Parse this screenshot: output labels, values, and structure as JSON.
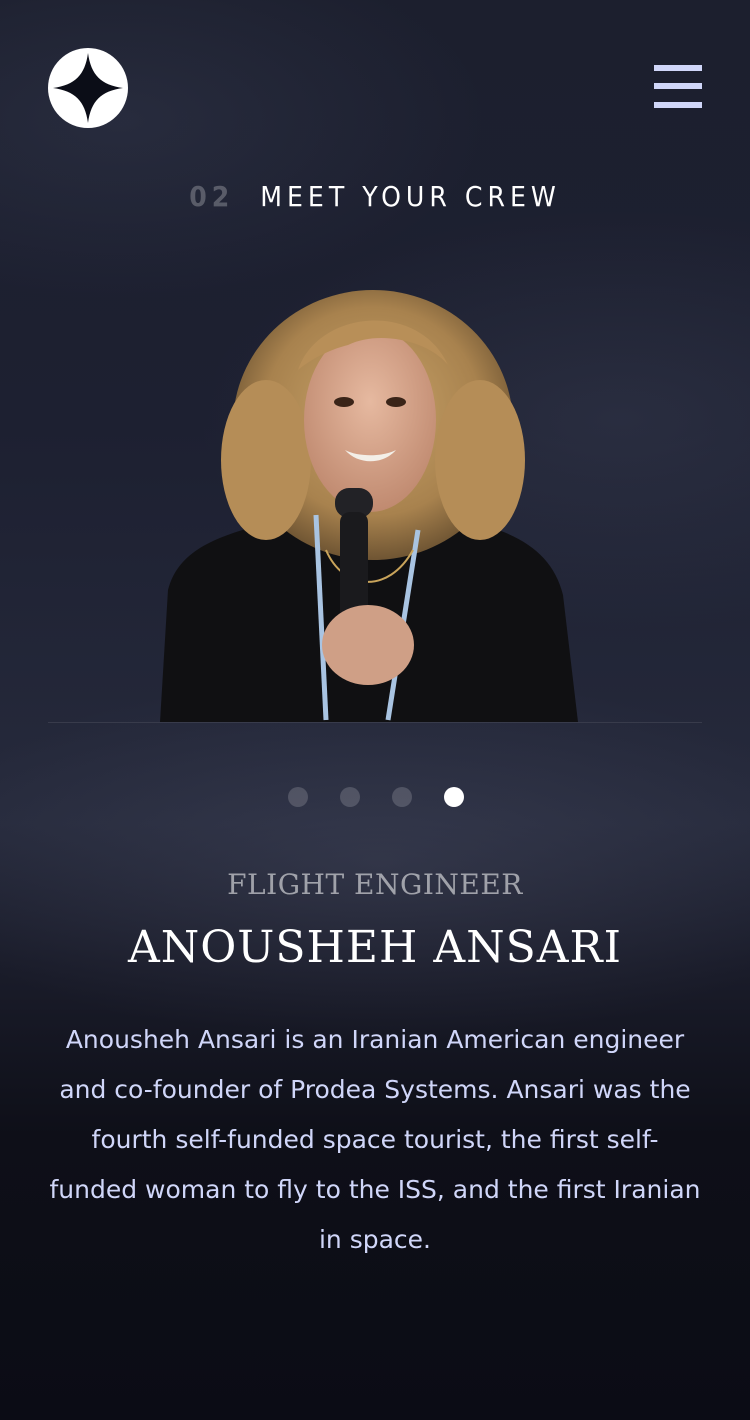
{
  "header": {
    "logo_icon": "four-point-star-icon",
    "menu_icon": "hamburger-menu-icon"
  },
  "page_heading": {
    "number": "02",
    "title": "MEET YOUR CREW"
  },
  "crew": {
    "role": "Flight Engineer",
    "name": "Anousheh Ansari",
    "bio": "Anousheh Ansari is an Iranian American engineer and co-founder of Prodea Systems. Ansari was the fourth self-funded space tourist, the first self-funded woman to fly to the ISS, and the first Iranian in space."
  },
  "pagination": {
    "total": 4,
    "active_index": 4
  },
  "colors": {
    "accent_light": "#d0d6f9",
    "background_dark": "#0b0d17",
    "white": "#ffffff"
  }
}
